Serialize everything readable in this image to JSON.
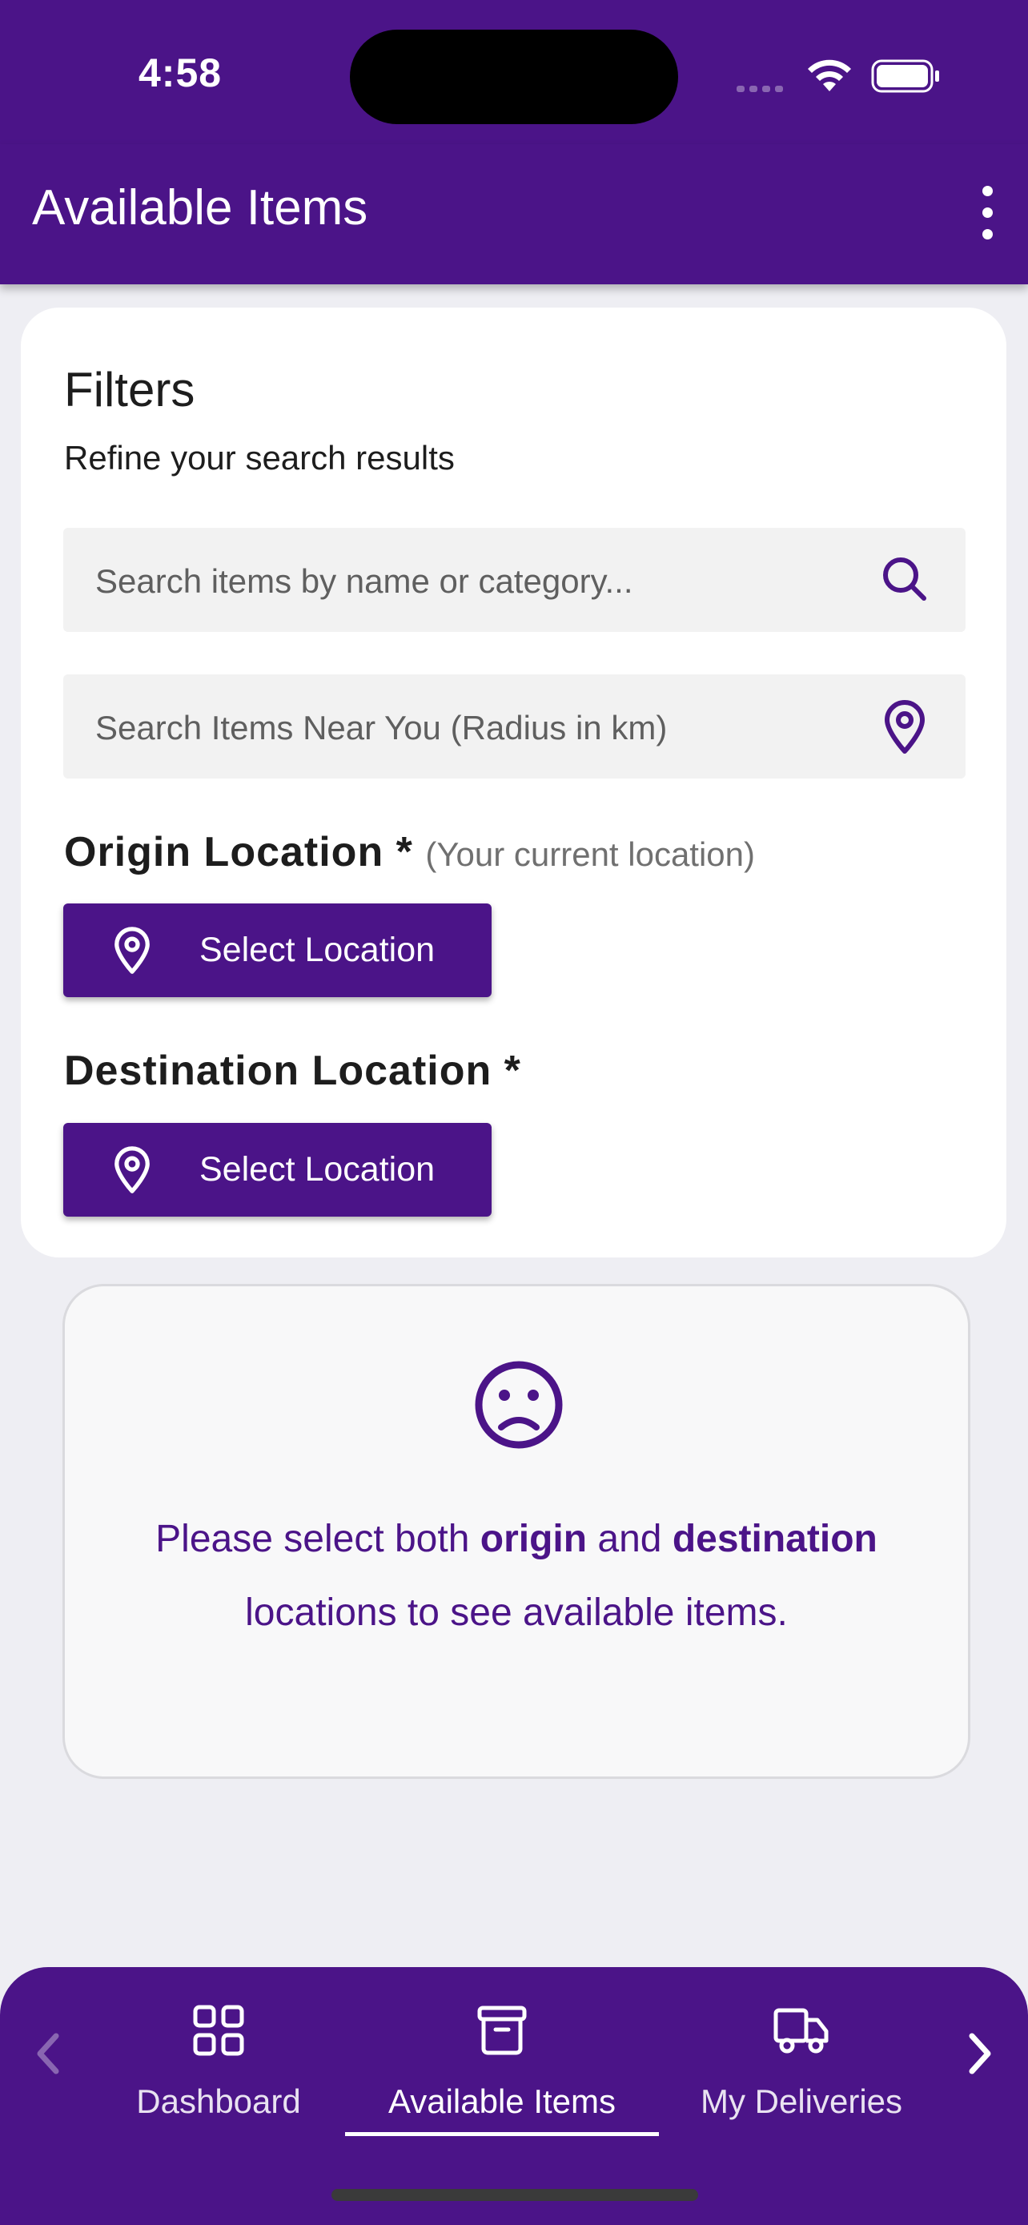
{
  "status_bar": {
    "time": "4:58"
  },
  "app_bar": {
    "title": "Available Items",
    "menu_icon": "more-vertical-icon"
  },
  "filters": {
    "title": "Filters",
    "subtitle": "Refine your search results",
    "search": {
      "placeholder": "Search items by name or category...",
      "icon": "search-icon"
    },
    "radius": {
      "placeholder": "Search Items Near You (Radius in km)",
      "icon": "map-pin-icon"
    },
    "origin": {
      "label": "Origin Location *",
      "hint": "(Your current location)",
      "button": "Select Location"
    },
    "destination": {
      "label": "Destination Location *",
      "button": "Select Location"
    }
  },
  "empty_state": {
    "icon": "sad-face-icon",
    "text_1": "Please select both ",
    "bold_1": "origin",
    "text_2": " and ",
    "bold_2": "destination",
    "text_3": " locations to see available items."
  },
  "bottom_nav": {
    "items": [
      {
        "label": "Dashboard",
        "icon": "grid-icon"
      },
      {
        "label": "Available Items",
        "icon": "archive-box-icon",
        "active": true
      },
      {
        "label": "My Deliveries",
        "icon": "truck-icon"
      }
    ]
  },
  "colors": {
    "primary": "#4b1488",
    "background": "#eeeef3",
    "card": "#ffffff"
  }
}
